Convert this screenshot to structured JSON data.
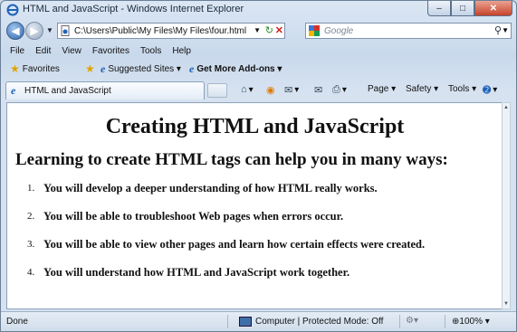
{
  "window": {
    "title": "HTML and JavaScript - Windows Internet Explorer",
    "controls": {
      "minimize": "–",
      "maximize": "□",
      "close": "✕"
    }
  },
  "address": {
    "url": "C:\\Users\\Public\\My Files\\My Files\\four.html",
    "refresh_glyph": "↻",
    "stop_glyph": "✕"
  },
  "search": {
    "placeholder": "Google"
  },
  "menu": [
    "File",
    "Edit",
    "View",
    "Favorites",
    "Tools",
    "Help"
  ],
  "favorites_bar": {
    "favorites": "Favorites",
    "suggested_sites": "Suggested Sites ▾",
    "get_addons": "Get More Add-ons ▾"
  },
  "tab": {
    "title": "HTML and JavaScript"
  },
  "commands": {
    "home": "▾",
    "feeds": "▾",
    "print": "▾",
    "page": "Page ▾",
    "safety": "Safety ▾",
    "tools": "Tools ▾",
    "help": "▾"
  },
  "page": {
    "heading": "Creating HTML and JavaScript",
    "subheading": "Learning to create HTML tags can help you in many ways:",
    "items": [
      {
        "num": "1.",
        "text": "You will develop a deeper understanding of how HTML really works."
      },
      {
        "num": "2.",
        "text": "You will be able to troubleshoot Web pages when errors occur."
      },
      {
        "num": "3.",
        "text": "You will be able to view other pages and learn how certain effects were created."
      },
      {
        "num": "4.",
        "text": "You will understand how HTML and JavaScript work together."
      }
    ]
  },
  "status": {
    "left": "Done",
    "zone": "Computer | Protected Mode: Off",
    "zoom": "⊕100% ▾"
  },
  "colors": {
    "accent": "#2f63a9",
    "close": "#c7432a",
    "frame": "#cfdbe8"
  }
}
